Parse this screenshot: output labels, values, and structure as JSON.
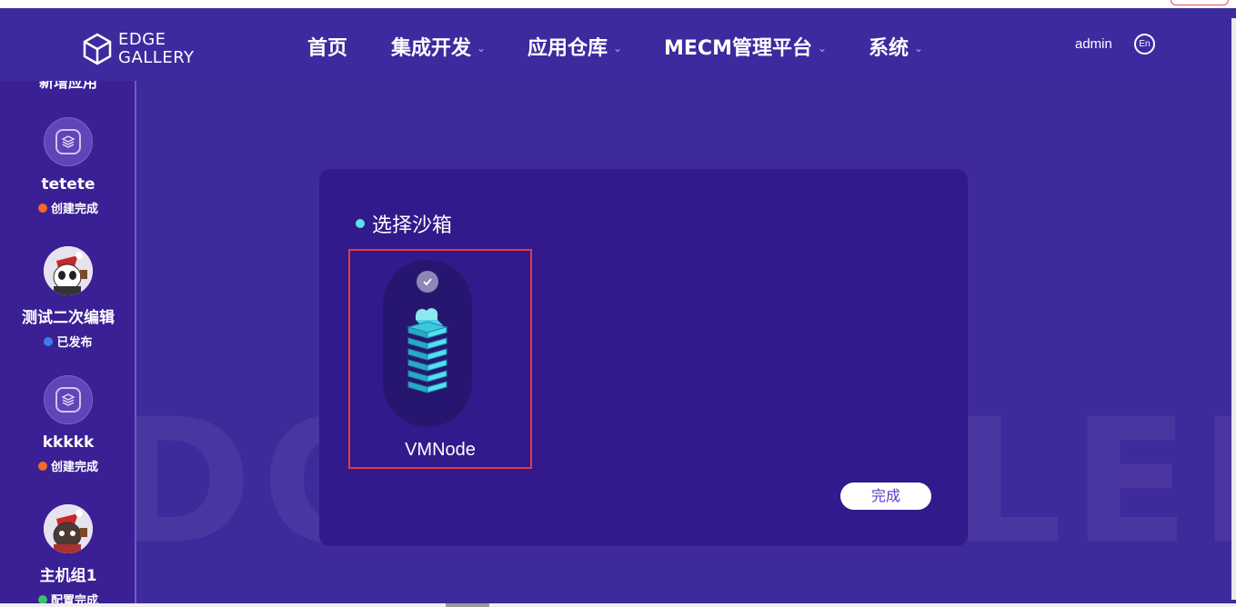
{
  "header": {
    "logo_line1": "EDGE",
    "logo_line2": "GALLERY",
    "nav": [
      {
        "label": "首页",
        "has_menu": false
      },
      {
        "label": "集成开发",
        "has_menu": true
      },
      {
        "label": "应用仓库",
        "has_menu": true
      },
      {
        "label": "MECM管理平台",
        "has_menu": true
      },
      {
        "label": "系统",
        "has_menu": true
      }
    ],
    "chevron": "⌄",
    "user": "admin",
    "lang": "En"
  },
  "sidebar": {
    "cut_label": "新增应用",
    "apps": [
      {
        "name": "tetete",
        "status": "创建完成",
        "status_color": "#f06a2a",
        "icon": "layers-icon"
      },
      {
        "name": "测试二次编辑",
        "status": "已发布",
        "status_color": "#3a7bf0",
        "icon": "panda-avatar"
      },
      {
        "name": "kkkkk",
        "status": "创建完成",
        "status_color": "#f06a2a",
        "icon": "layers-icon"
      },
      {
        "name": "主机组1",
        "status": "配置完成",
        "status_color": "#38c26b",
        "icon": "panda-avatar"
      }
    ]
  },
  "watermark": "EDGEGALLERY",
  "panel": {
    "title": "选择沙箱",
    "sandbox_label": "VMNode",
    "done_label": "完成"
  },
  "colors": {
    "background": "#3f2a9c",
    "panel": "#32198c",
    "accent": "#5ce1e6",
    "selection_border": "#e53b3b"
  }
}
